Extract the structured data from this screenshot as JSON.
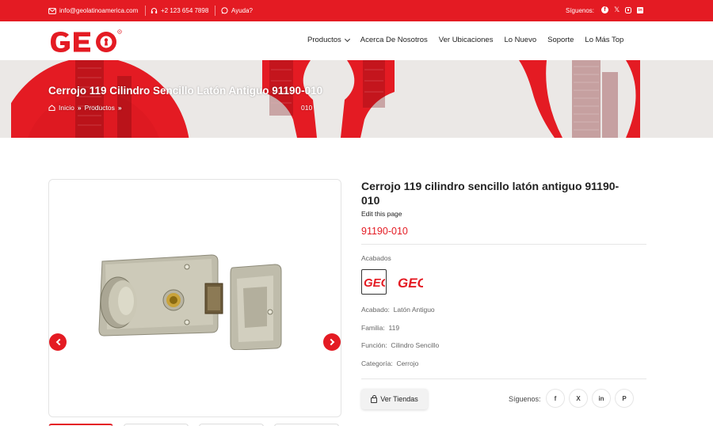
{
  "topbar": {
    "email": "info@geolatinoamerica.com",
    "phone": "+2 123 654 7898",
    "help": "Ayuda?",
    "follow_label": "Síguenos:",
    "socials": [
      "facebook-icon",
      "x-icon",
      "instagram-icon",
      "linkedin-icon"
    ]
  },
  "header": {
    "logo_text": "GEO",
    "nav": [
      "Productos",
      "Acerca De Nosotros",
      "Ver Ubicaciones",
      "Lo Nuevo",
      "Soporte",
      "Lo Más Top"
    ]
  },
  "banner": {
    "title": "Cerrojo 119 Cilindro Sencillo Latón Antiguo 91190-010",
    "crumb_home": "Inicio",
    "crumb_products": "Productos",
    "crumb_tail": "010"
  },
  "product": {
    "title": "Cerrojo 119 cilindro sencillo latón antiguo 91190-010",
    "edit": "Edit this page",
    "sku": "91190-010",
    "acabados_label": "Acabados",
    "specs": [
      {
        "label": "Acabado:",
        "value": "Latón Antiguo"
      },
      {
        "label": "Familia:",
        "value": "119"
      },
      {
        "label": "Función:",
        "value": "Cilindro Sencillo"
      },
      {
        "label": "Categoría:",
        "value": "Cerrojo"
      }
    ],
    "stores_button": "Ver Tiendas",
    "share_label": "Síguenos:",
    "share_icons": [
      "f",
      "X",
      "in",
      "P"
    ]
  },
  "colors": {
    "brand": "#e41b23",
    "banner_bg": "#e9e6e4"
  }
}
